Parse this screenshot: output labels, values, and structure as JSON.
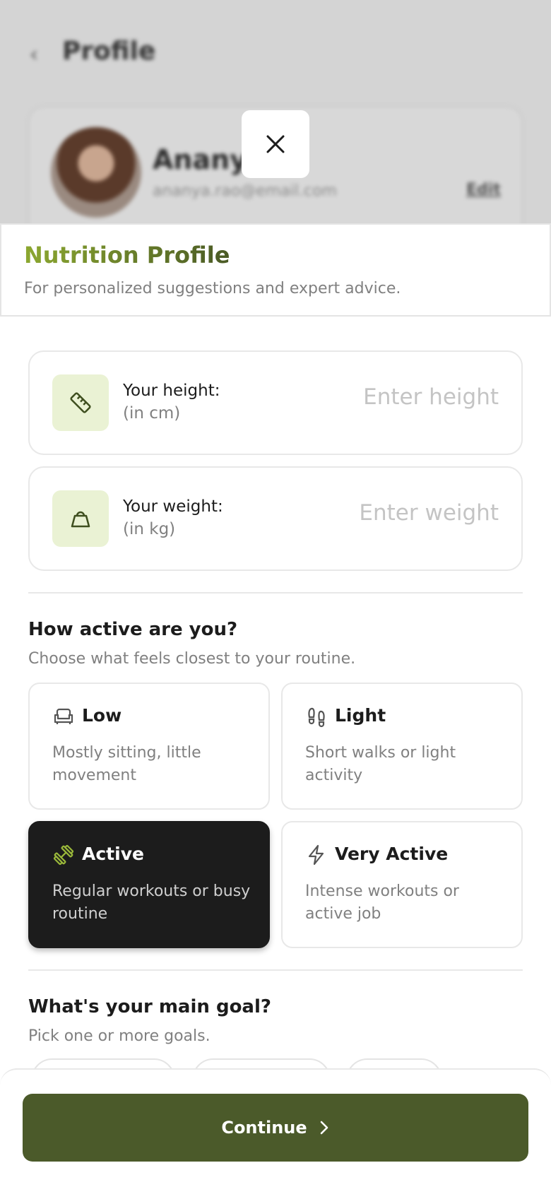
{
  "background": {
    "title": "Profile",
    "user_name": "Ananya",
    "user_email": "ananya.rao@email.com",
    "edit_label": "Edit"
  },
  "sheet": {
    "title": "Nutrition Profile",
    "subtitle": "For personalized suggestions and expert advice."
  },
  "height": {
    "label": "Your height:",
    "unit": "(in cm)",
    "placeholder": "Enter height",
    "icon": "ruler-icon"
  },
  "weight": {
    "label": "Your weight:",
    "unit": "(in kg)",
    "placeholder": "Enter weight",
    "icon": "weight-icon"
  },
  "activity": {
    "title": "How active are you?",
    "subtitle": "Choose what feels closest to your routine.",
    "options": [
      {
        "label": "Low",
        "desc": "Mostly sitting, little movement",
        "icon": "armchair-icon",
        "selected": false
      },
      {
        "label": "Light",
        "desc": "Short walks or light activity",
        "icon": "footprints-icon",
        "selected": false
      },
      {
        "label": "Active",
        "desc": "Regular workouts or busy routine",
        "icon": "dumbbell-icon",
        "selected": true
      },
      {
        "label": "Very Active",
        "desc": "Intense workouts or active job",
        "icon": "lightning-icon",
        "selected": false
      }
    ]
  },
  "goal": {
    "title": "What's your main goal?",
    "subtitle": "Pick one or more goals."
  },
  "footer": {
    "continue_label": "Continue"
  },
  "colors": {
    "brand": "#4b5a2a",
    "accent_light": "#eaf2d4",
    "accent_green": "#8ca830",
    "selected_bg": "#1c1c1c"
  }
}
